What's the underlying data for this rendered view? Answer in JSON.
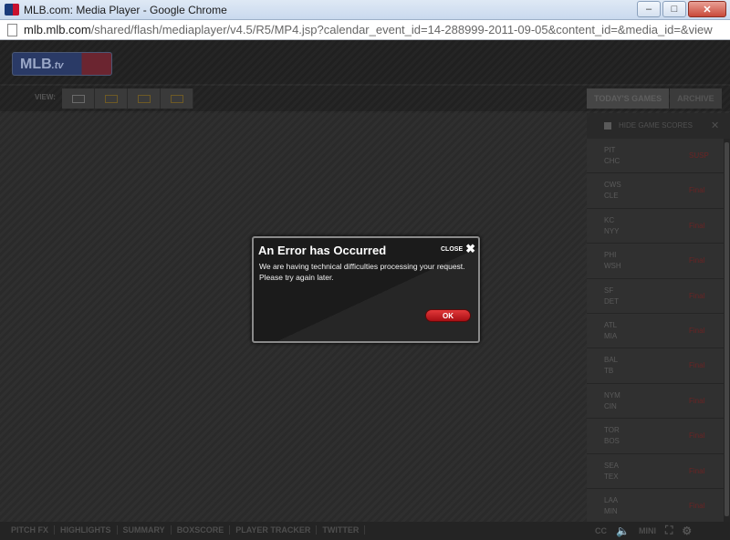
{
  "window": {
    "title": "MLB.com: Media Player - Google Chrome",
    "minimize_glyph": "–",
    "maximize_glyph": "□",
    "close_glyph": "✕"
  },
  "address": {
    "host": "mlb.mlb.com",
    "path": "/shared/flash/mediaplayer/v4.5/R5/MP4.jsp?calendar_event_id=14-288999-2011-09-05&content_id=&media_id=&view"
  },
  "player": {
    "logo_text": "MLB",
    "logo_suffix": ".tv",
    "view_label": "VIEW:",
    "tabs": [
      {
        "label": "TODAY'S GAMES"
      },
      {
        "label": "ARCHIVE"
      }
    ],
    "sidebar": {
      "hide_scores_label": "HIDE GAME SCORES",
      "games": [
        {
          "away": "PIT",
          "home": "CHC",
          "status": "SUSP"
        },
        {
          "away": "CWS",
          "home": "CLE",
          "status": "Final"
        },
        {
          "away": "KC",
          "home": "NYY",
          "status": "Final"
        },
        {
          "away": "PHI",
          "home": "WSH",
          "status": "Final"
        },
        {
          "away": "SF",
          "home": "DET",
          "status": "Final"
        },
        {
          "away": "ATL",
          "home": "MIA",
          "status": "Final"
        },
        {
          "away": "BAL",
          "home": "TB",
          "status": "Final"
        },
        {
          "away": "NYM",
          "home": "CIN",
          "status": "Final"
        },
        {
          "away": "TOR",
          "home": "BOS",
          "status": "Final"
        },
        {
          "away": "SEA",
          "home": "TEX",
          "status": "Final"
        },
        {
          "away": "LAA",
          "home": "MIN",
          "status": "Final"
        }
      ]
    },
    "bottom_nav": [
      "PITCH FX",
      "HIGHLIGHTS",
      "SUMMARY",
      "BOXSCORE",
      "PLAYER TRACKER",
      "TWITTER"
    ],
    "bottom_right": {
      "cc": "CC",
      "mini": "MINI"
    }
  },
  "dialog": {
    "title": "An Error has Occurred",
    "close_label": "CLOSE",
    "message": "We are having technical difficulties processing your request. Please try again later.",
    "ok_label": "OK"
  }
}
